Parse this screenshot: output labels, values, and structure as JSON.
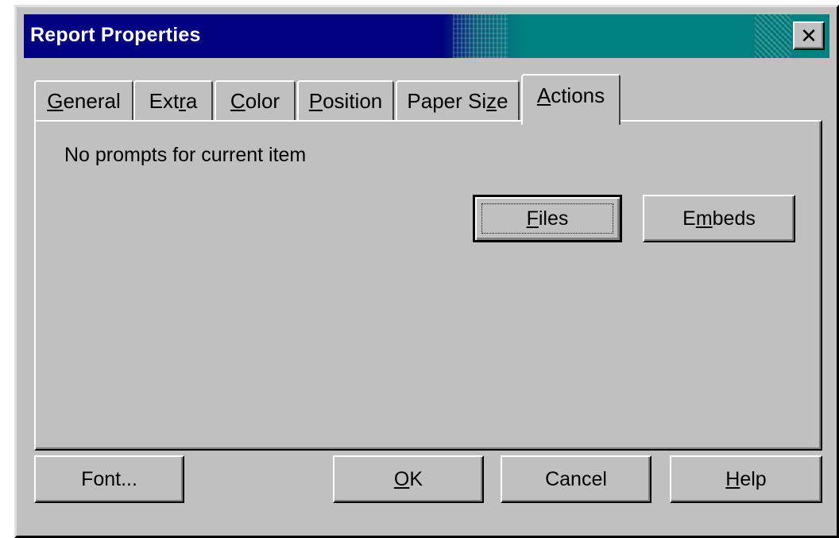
{
  "window": {
    "title": "Report Properties",
    "close_glyph": "✕"
  },
  "tabs": [
    {
      "label_pre": "",
      "label_accel": "G",
      "label_post": "eneral",
      "active": false
    },
    {
      "label_pre": "Ext",
      "label_accel": "r",
      "label_post": "a",
      "active": false
    },
    {
      "label_pre": "",
      "label_accel": "C",
      "label_post": "olor",
      "active": false
    },
    {
      "label_pre": "",
      "label_accel": "P",
      "label_post": "osition",
      "active": false
    },
    {
      "label_pre": "Paper Si",
      "label_accel": "z",
      "label_post": "e",
      "active": false
    },
    {
      "label_pre": "",
      "label_accel": "A",
      "label_post": "ctions",
      "active": true
    }
  ],
  "panel": {
    "prompt": "No prompts for current item",
    "files_button": {
      "label_pre": "",
      "label_accel": "F",
      "label_post": "iles"
    },
    "embeds_button": {
      "label_pre": "E",
      "label_accel": "m",
      "label_post": "beds"
    }
  },
  "footer": {
    "font_button": "Font...",
    "ok_button": {
      "label_pre": "",
      "label_accel": "O",
      "label_post": "K"
    },
    "cancel_button": "Cancel",
    "help_button": {
      "label_pre": "",
      "label_accel": "H",
      "label_post": "elp"
    }
  },
  "colors": {
    "face": "#c0c0c0",
    "title_active": "#000080",
    "title_accent": "#008080"
  }
}
